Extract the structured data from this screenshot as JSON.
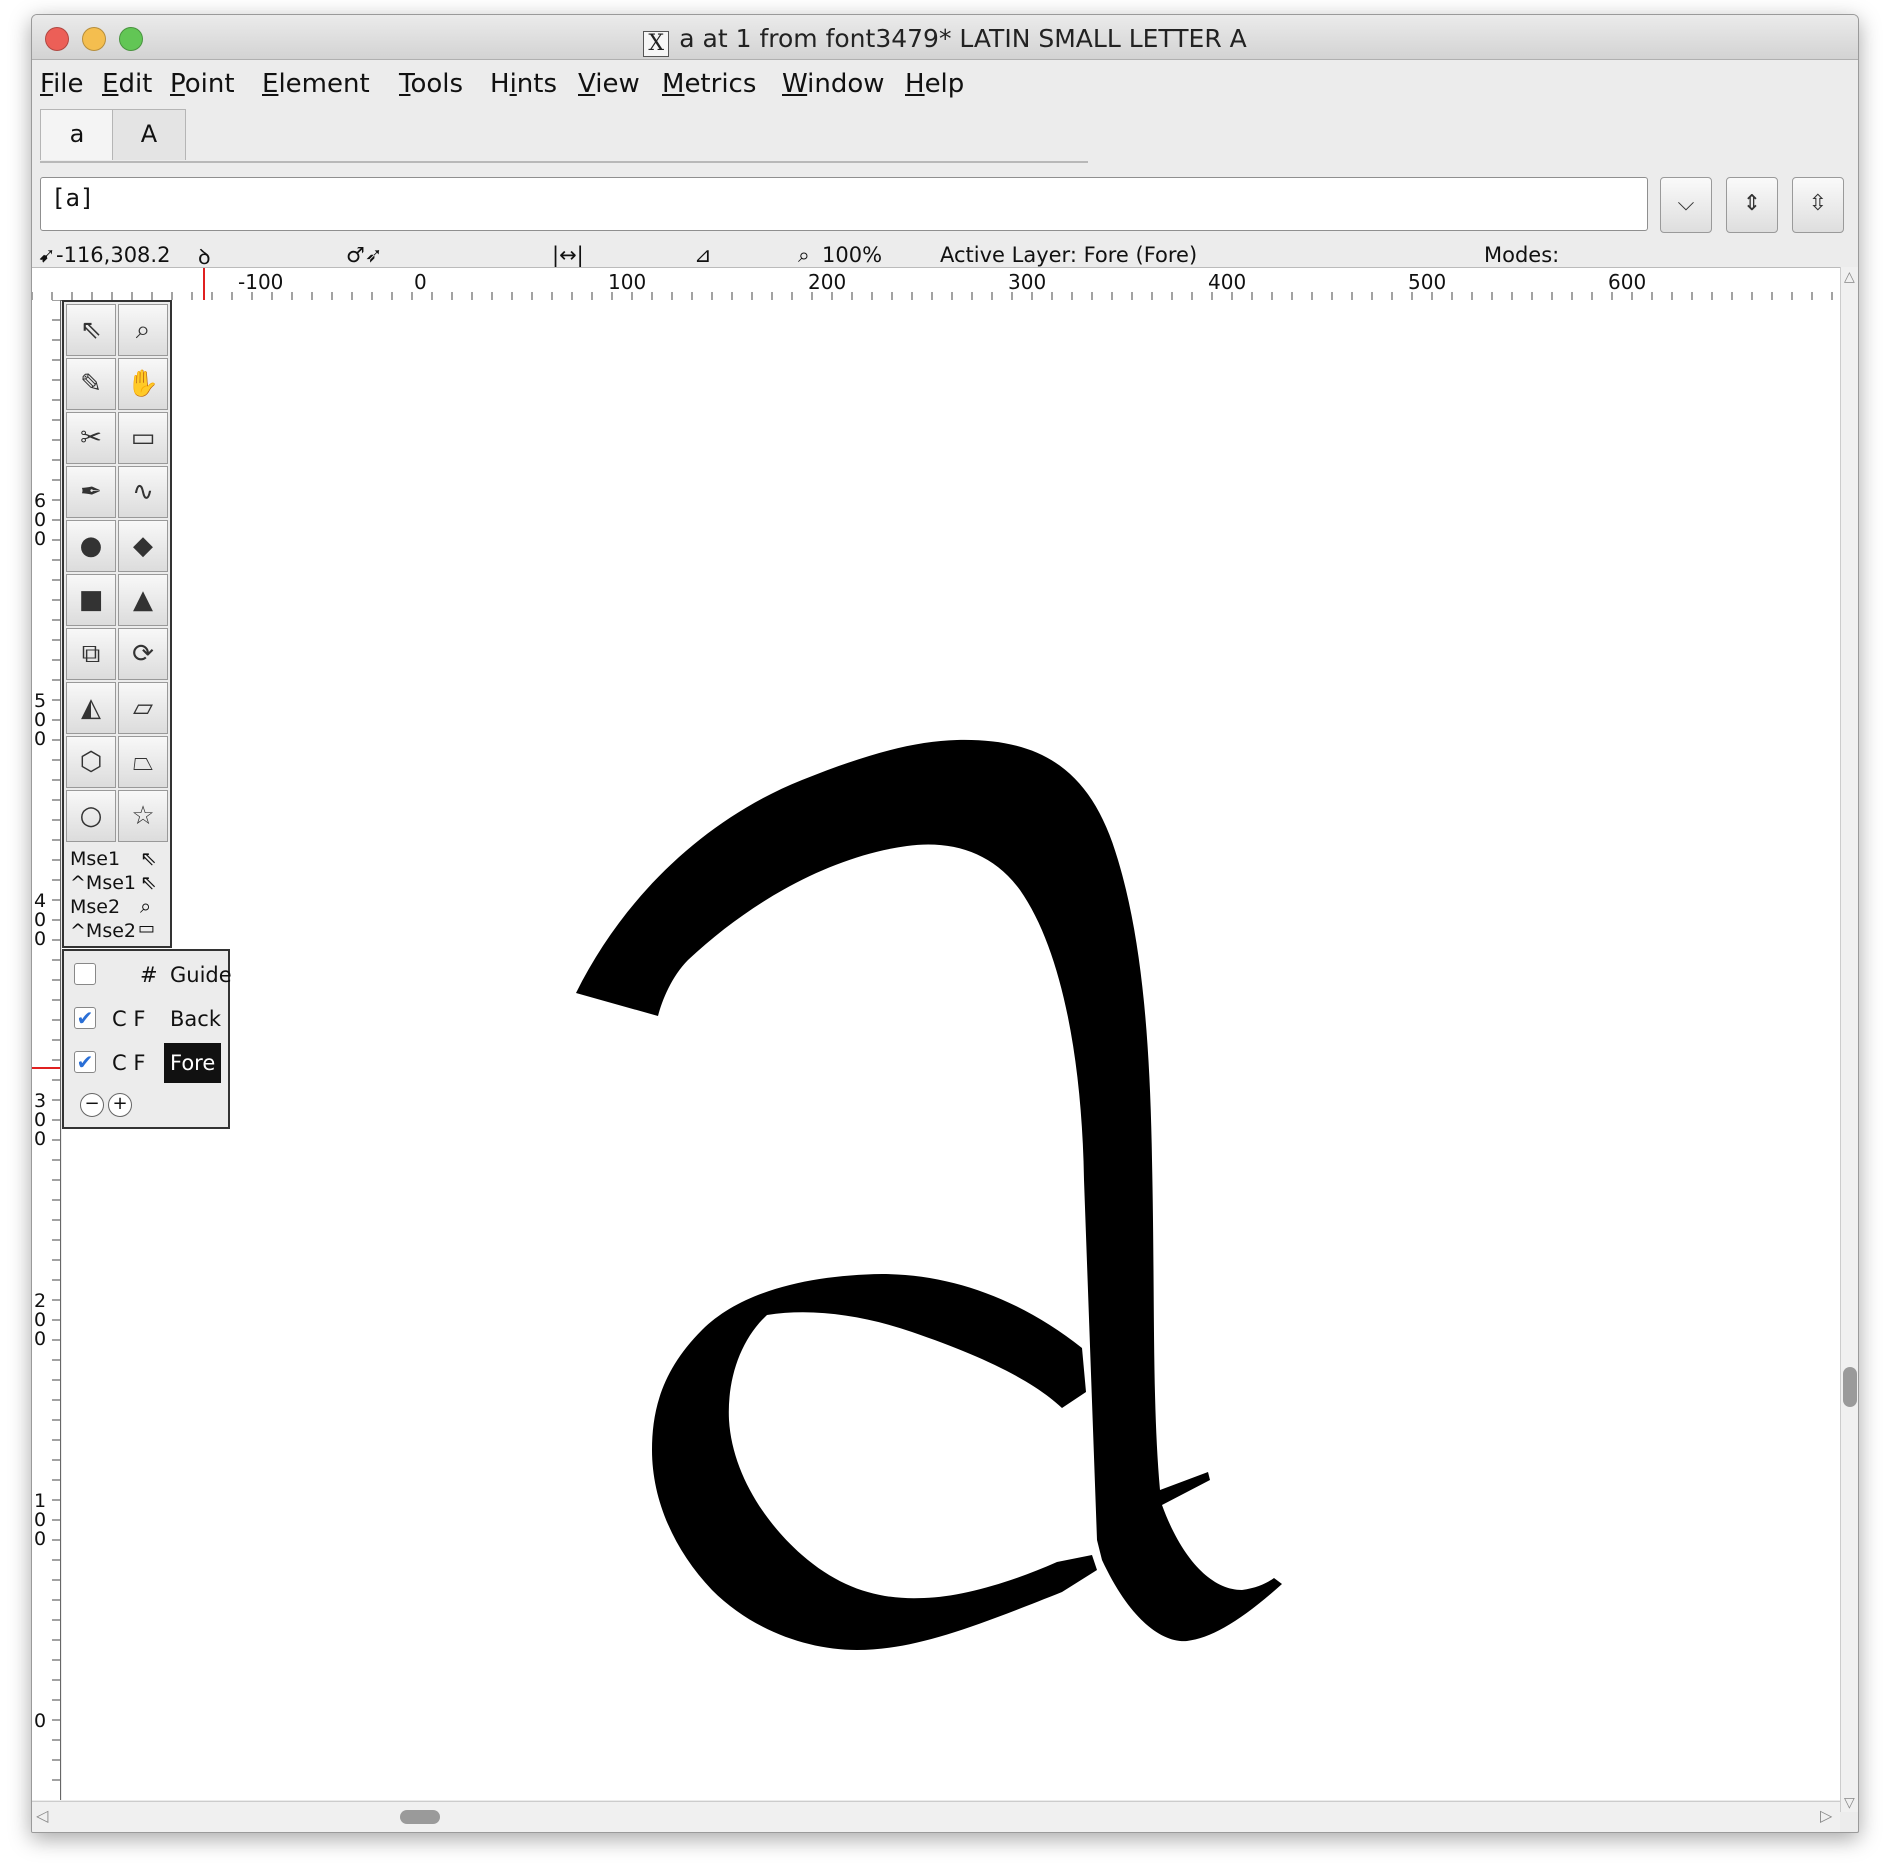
{
  "window": {
    "title": "a at 1 from font3479* LATIN SMALL LETTER A",
    "title_icon": "x11-icon",
    "traffic_lights": {
      "close": "#ec5f57",
      "minimize": "#f4be4f",
      "zoom": "#62c655"
    }
  },
  "menu": [
    "File",
    "Edit",
    "Point",
    "Element",
    "Tools",
    "Hints",
    "View",
    "Metrics",
    "Window",
    "Help"
  ],
  "menu_underline": [
    "F",
    "E",
    "P",
    "E",
    "T",
    "i",
    "V",
    "M",
    "W",
    "H"
  ],
  "tabs": [
    "a",
    "A"
  ],
  "glyph_text": "[a]",
  "spin_buttons": [
    "chevron-down-icon",
    "arrows-vertical-icon",
    "arrows-vertical-icon"
  ],
  "status": {
    "coords": "-116,308.2",
    "zoom": "100%",
    "active_layer": "Active Layer: Fore (Fore)",
    "modes": "Modes:"
  },
  "hruler_labels": [
    "-100",
    "0",
    "100",
    "200",
    "300",
    "400",
    "500",
    "600"
  ],
  "vruler_labels": [
    "600",
    "500",
    "400",
    "300",
    "200",
    "100",
    "0"
  ],
  "tool_icons": [
    [
      "pointer-icon",
      "magnify-icon"
    ],
    [
      "freehand-icon",
      "hand-icon"
    ],
    [
      "knife-icon",
      "ruler-icon"
    ],
    [
      "pen-icon",
      "spiro-icon"
    ],
    [
      "curve-point-icon",
      "hv-curve-point-icon"
    ],
    [
      "corner-point-icon",
      "tangent-point-icon"
    ],
    [
      "scale-icon",
      "rotate-icon"
    ],
    [
      "flip-icon",
      "skew-icon"
    ],
    [
      "3d-rotate-icon",
      "perspective-icon"
    ],
    [
      "ellipse-icon",
      "star-icon"
    ]
  ],
  "mouse_bindings": [
    "Mse1",
    "^Mse1",
    "Mse2",
    "^Mse2"
  ],
  "layers": [
    {
      "checked": false,
      "cf": "#",
      "name": "Guide",
      "selected": false
    },
    {
      "checked": true,
      "cf": "C F",
      "name": "Back",
      "selected": false
    },
    {
      "checked": true,
      "cf": "C F",
      "name": "Fore",
      "selected": true
    }
  ],
  "layer_buttons": [
    "−",
    "+"
  ],
  "glyph": {
    "fill": "#000000"
  }
}
